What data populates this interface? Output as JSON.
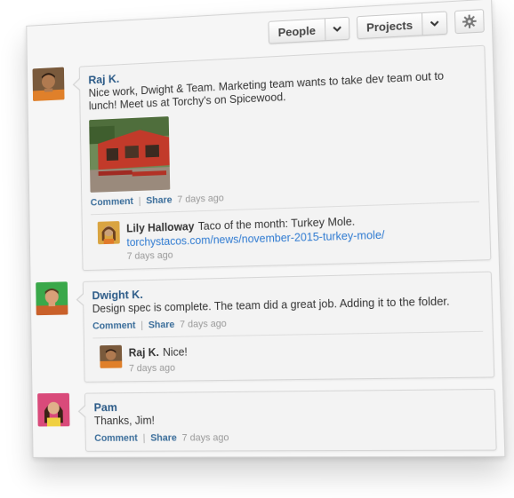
{
  "toolbar": {
    "people_label": "People",
    "projects_label": "Projects"
  },
  "icons": {
    "gear": "gear-icon",
    "chevron": "chevron-down-icon"
  },
  "actions": {
    "comment_label": "Comment",
    "share_label": "Share",
    "separator": "|"
  },
  "posts": [
    {
      "author": "Raj K.",
      "message": "Nice work, Dwight & Team. Marketing team wants to take dev team out to lunch! Meet us at Torchy's on Spicewood.",
      "time": "7 days ago",
      "reply": {
        "author": "Lily Halloway",
        "text": "Taco of the month: Turkey Mole.",
        "link": "torchystacos.com/news/november-2015-turkey-mole/",
        "time": "7 days ago"
      }
    },
    {
      "author": "Dwight K.",
      "message": "Design spec is complete. The team did a great job. Adding it to the folder.",
      "time": "7 days ago",
      "reply": {
        "author": "Raj K.",
        "text": "Nice!",
        "time": "7 days ago"
      }
    },
    {
      "author": "Pam",
      "message": "Thanks, Jim!",
      "time": "7 days ago"
    }
  ],
  "colors": {
    "author": "#2b5a87",
    "link": "#2e7ad1",
    "panel": "#f6f6f6"
  }
}
